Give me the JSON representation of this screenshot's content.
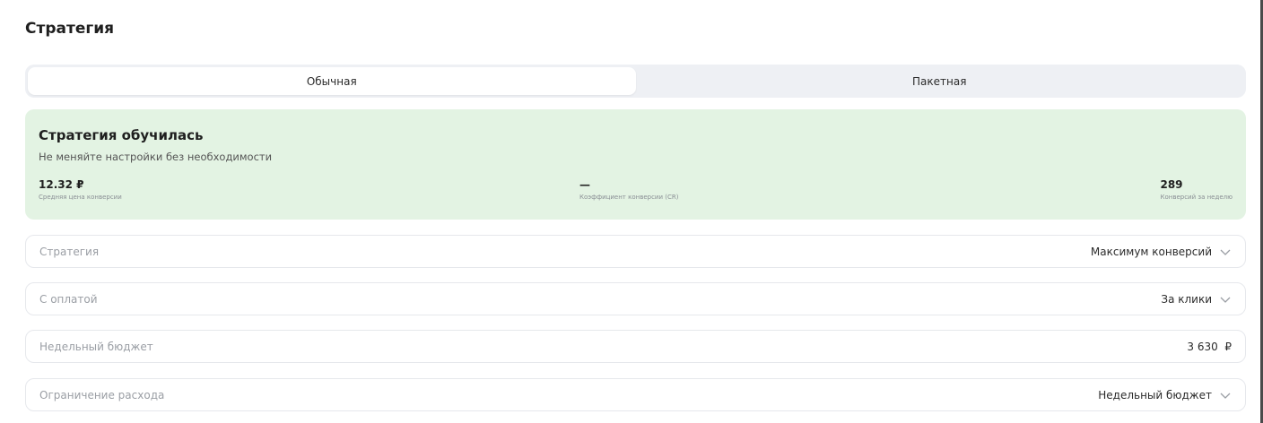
{
  "section": {
    "title": "Стратегия"
  },
  "tabs": [
    {
      "label": "Обычная",
      "active": true
    },
    {
      "label": "Пакетная",
      "active": false
    }
  ],
  "status": {
    "title": "Стратегия обучилась",
    "subtitle": "Не меняйте настройки без необходимости",
    "metrics": [
      {
        "value": "12.32 ₽",
        "label": "Средняя цена конверсии"
      },
      {
        "value": "—",
        "label": "Коэффициент конверсии (CR)"
      },
      {
        "value": "289",
        "label": "Конверсий за неделю"
      }
    ],
    "background_color": "#e3f3e3"
  },
  "fields": [
    {
      "label": "Стратегия",
      "value": "Максимум конверсий",
      "icon": "chevron-down-icon"
    },
    {
      "label": "С оплатой",
      "value": "За клики",
      "icon": "chevron-down-icon"
    },
    {
      "label": "Недельный бюджет",
      "value": "3 630  ₽"
    },
    {
      "label": "Ограничение расхода",
      "value": "Недельный бюджет",
      "icon": "chevron-down-icon"
    }
  ]
}
